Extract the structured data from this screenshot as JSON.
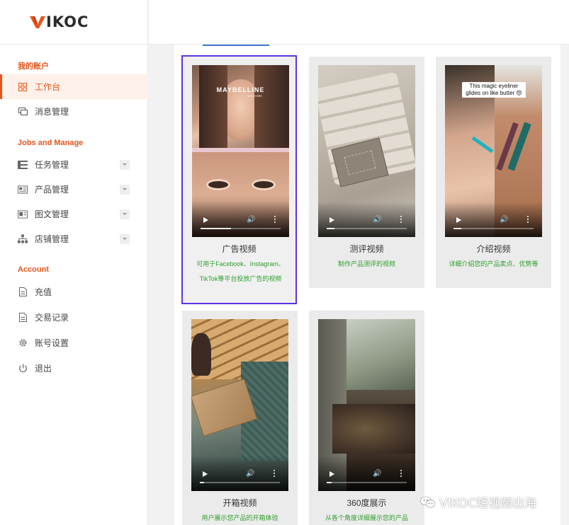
{
  "brand": {
    "name": "VIKOC",
    "accent": "#e8541b"
  },
  "sidebar": {
    "sections": [
      {
        "title": "我的账户",
        "items": [
          {
            "label": "工作台",
            "icon": "dashboard-icon",
            "active": true
          },
          {
            "label": "消息管理",
            "icon": "message-icon"
          }
        ]
      },
      {
        "title": "Jobs and Manage",
        "items": [
          {
            "label": "任务管理",
            "icon": "task-icon",
            "expandable": true
          },
          {
            "label": "产品管理",
            "icon": "product-icon",
            "expandable": true
          },
          {
            "label": "图文管理",
            "icon": "image-text-icon",
            "expandable": true
          },
          {
            "label": "店铺管理",
            "icon": "store-icon",
            "expandable": true
          }
        ]
      },
      {
        "title": "Account",
        "items": [
          {
            "label": "充值",
            "icon": "document-icon"
          },
          {
            "label": "交易记录",
            "icon": "document-icon"
          },
          {
            "label": "账号设置",
            "icon": "gear-icon"
          },
          {
            "label": "退出",
            "icon": "power-icon"
          }
        ]
      }
    ]
  },
  "cards": [
    {
      "title": "广告视频",
      "desc": [
        "可用于Facebook、Instagram、",
        "TikTok等平台投放广告的视频"
      ],
      "selected": true,
      "overlay": "MAYBELLINE",
      "overlay_sub": "NEW YORK"
    },
    {
      "title": "测评视频",
      "desc": [
        "制作产品测评的视频"
      ]
    },
    {
      "title": "介绍视频",
      "desc": [
        "详细介绍您的产品卖点、优势等"
      ],
      "overlay": "This magic eyeliner glides on like butter 😍"
    },
    {
      "title": "开箱视频",
      "desc": [
        "用户展示您产品的开箱体验"
      ]
    },
    {
      "title": "360度展示",
      "desc": [
        "从各个角度详细展示您的产品"
      ]
    }
  ],
  "watermark": "VIKOC短视频出海"
}
